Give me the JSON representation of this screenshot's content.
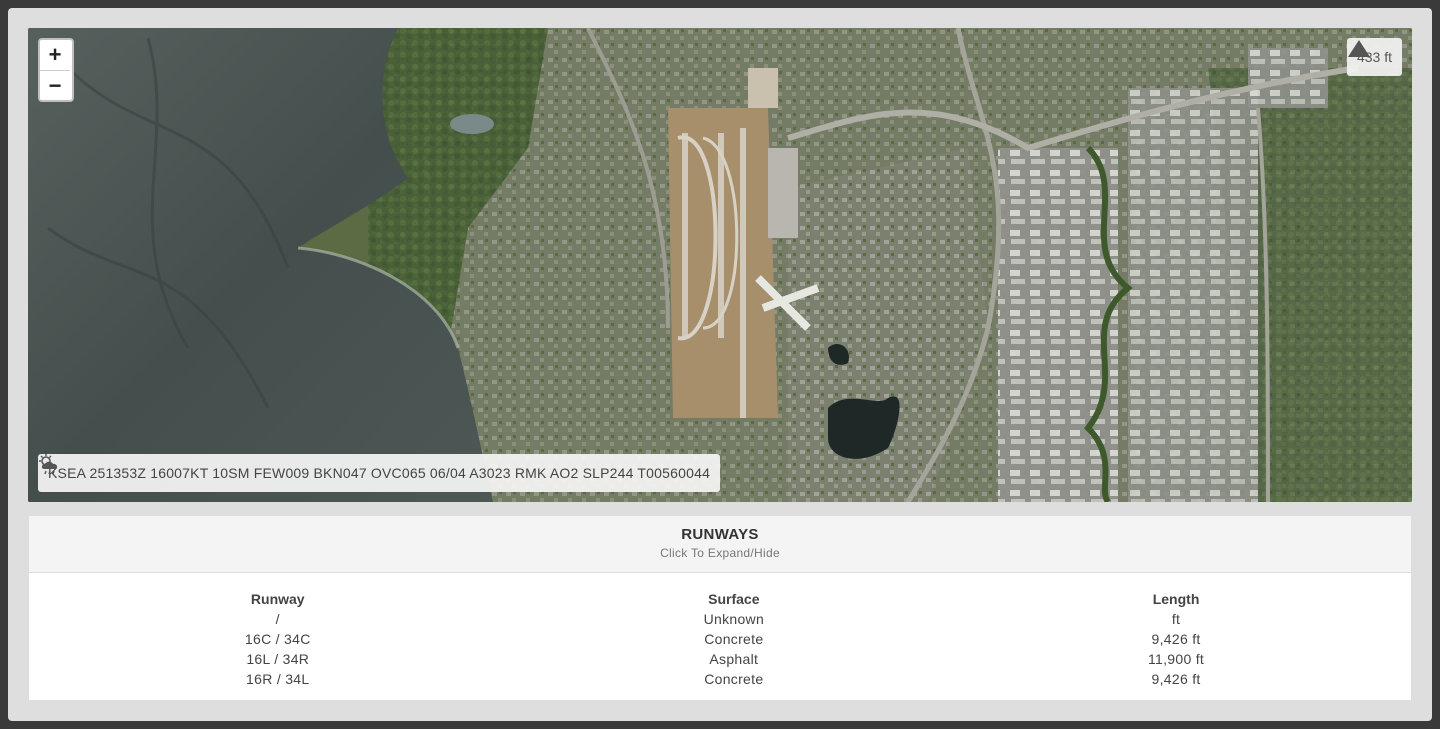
{
  "map": {
    "zoom_in_label": "+",
    "zoom_out_label": "−",
    "elevation": "433 ft",
    "metar": "KSEA 251353Z 16007KT 10SM FEW009 BKN047 OVC065 06/04 A3023 RMK AO2 SLP244 T00560044"
  },
  "runways": {
    "title": "RUNWAYS",
    "subtitle": "Click To Expand/Hide",
    "headers": {
      "runway": "Runway",
      "surface": "Surface",
      "length": "Length"
    },
    "rows": [
      {
        "runway": "/",
        "surface": "Unknown",
        "length": "ft"
      },
      {
        "runway": "16C / 34C",
        "surface": "Concrete",
        "length": "9,426 ft"
      },
      {
        "runway": "16L / 34R",
        "surface": "Asphalt",
        "length": "11,900 ft"
      },
      {
        "runway": "16R / 34L",
        "surface": "Concrete",
        "length": "9,426 ft"
      }
    ]
  },
  "colors": {
    "water": "#4a5552",
    "land": "#5d6b45",
    "urban": "#8a8c86",
    "runway": "#c7b79a"
  }
}
